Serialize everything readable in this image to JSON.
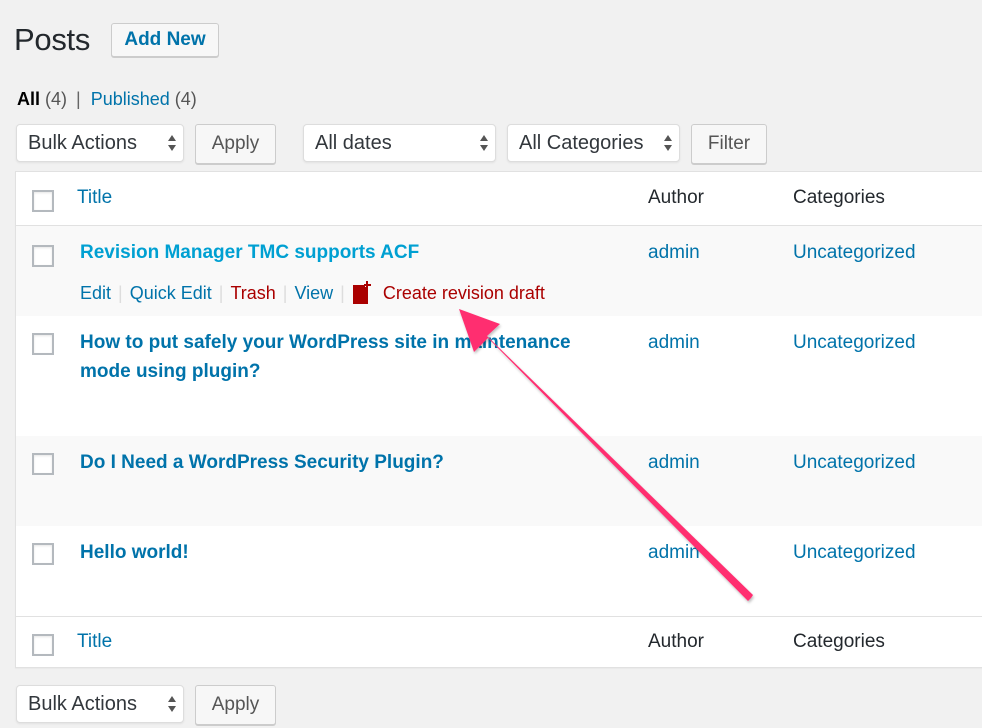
{
  "header": {
    "title": "Posts",
    "add_new_label": "Add New"
  },
  "views": {
    "all_label": "All",
    "all_count": "(4)",
    "separator": "|",
    "published_label": "Published",
    "published_count": "(4)"
  },
  "filters": {
    "bulk_actions": "Bulk Actions",
    "apply_label": "Apply",
    "dates": "All dates",
    "categories": "All Categories",
    "filter_label": "Filter"
  },
  "table": {
    "columns": {
      "title": "Title",
      "author": "Author",
      "categories": "Categories"
    },
    "rows": [
      {
        "title": "Revision Manager TMC supports ACF",
        "author": "admin",
        "category": "Uncategorized",
        "actions": {
          "edit": "Edit",
          "quick_edit": "Quick Edit",
          "trash": "Trash",
          "view": "View",
          "create_revision": "Create revision draft",
          "separator": "|"
        }
      },
      {
        "title": "How to put safely your WordPress site in maintenance mode using plugin?",
        "author": "admin",
        "category": "Uncategorized"
      },
      {
        "title": "Do I Need a WordPress Security Plugin?",
        "author": "admin",
        "category": "Uncategorized"
      },
      {
        "title": "Hello world!",
        "author": "admin",
        "category": "Uncategorized"
      }
    ]
  },
  "bottom_bar": {
    "bulk_actions": "Bulk Actions",
    "apply_label": "Apply"
  },
  "annotation": {
    "type": "arrow",
    "color": "#ff2d6f",
    "points_to": "Create revision draft"
  },
  "colors": {
    "link": "#0073aa",
    "link_hover": "#00a0d2",
    "danger": "#aa0000",
    "background": "#f1f1f1"
  }
}
